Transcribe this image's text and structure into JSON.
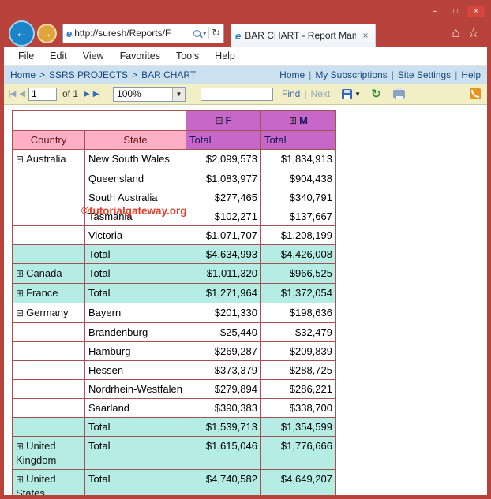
{
  "window": {
    "controls": {
      "minimize": "–",
      "maximize": "□",
      "close": "×"
    }
  },
  "browser": {
    "back_icon": "←",
    "forward_icon": "→",
    "ie_icon": "e",
    "address": {
      "url": "http://suresh/Reports/F",
      "caret": "▾",
      "refresh": "↻"
    },
    "tab": {
      "title": "BAR CHART - Report Mana...",
      "close": "×"
    },
    "home_icon": "⌂",
    "star_icon": "☆"
  },
  "menu": {
    "items": [
      "File",
      "Edit",
      "View",
      "Favorites",
      "Tools",
      "Help"
    ]
  },
  "breadcrumb": {
    "items": [
      "Home",
      "SSRS PROJECTS",
      "BAR CHART"
    ],
    "separator": ">"
  },
  "site_links": {
    "items": [
      "Home",
      "My Subscriptions",
      "Site Settings",
      "Help"
    ],
    "separator": "|"
  },
  "toolbar": {
    "first": "|◀",
    "prev": "◀",
    "page_value": "1",
    "page_of": "of 1",
    "next": "▶",
    "last": "▶|",
    "zoom_value": "100%",
    "zoom_caret": "▼",
    "find_label": "Find",
    "find_separator": "|",
    "next_label": "Next",
    "export_caret": "▼",
    "refresh_icon": "↻"
  },
  "report": {
    "watermark": "©tutorialgateway.org",
    "header": {
      "expand_collapsed": "⊞",
      "expand_expanded": "⊟",
      "f_label": "F",
      "m_label": "M",
      "total_label": "Total",
      "country_label": "Country",
      "state_label": "State"
    },
    "rows": [
      {
        "country": "Australia",
        "expand": "expanded",
        "state": "New South Wales",
        "f": "$2,099,573",
        "m": "$1,834,913",
        "total": false
      },
      {
        "country": "",
        "expand": null,
        "state": "Queensland",
        "f": "$1,083,977",
        "m": "$904,438",
        "total": false
      },
      {
        "country": "",
        "expand": null,
        "state": "South Australia",
        "f": "$277,465",
        "m": "$340,791",
        "total": false
      },
      {
        "country": "",
        "expand": null,
        "state": "Tasmania",
        "f": "$102,271",
        "m": "$137,667",
        "total": false
      },
      {
        "country": "",
        "expand": null,
        "state": "Victoria",
        "f": "$1,071,707",
        "m": "$1,208,199",
        "total": false
      },
      {
        "country": "",
        "expand": null,
        "state": "Total",
        "f": "$4,634,993",
        "m": "$4,426,008",
        "total": true
      },
      {
        "country": "Canada",
        "expand": "collapsed",
        "state": "Total",
        "f": "$1,011,320",
        "m": "$966,525",
        "total": true
      },
      {
        "country": "France",
        "expand": "collapsed",
        "state": "Total",
        "f": "$1,271,964",
        "m": "$1,372,054",
        "total": true
      },
      {
        "country": "Germany",
        "expand": "expanded",
        "state": "Bayern",
        "f": "$201,330",
        "m": "$198,636",
        "total": false
      },
      {
        "country": "",
        "expand": null,
        "state": "Brandenburg",
        "f": "$25,440",
        "m": "$32,479",
        "total": false
      },
      {
        "country": "",
        "expand": null,
        "state": "Hamburg",
        "f": "$269,287",
        "m": "$209,839",
        "total": false
      },
      {
        "country": "",
        "expand": null,
        "state": "Hessen",
        "f": "$373,379",
        "m": "$288,725",
        "total": false
      },
      {
        "country": "",
        "expand": null,
        "state": "Nordrhein-Westfalen",
        "f": "$279,894",
        "m": "$286,221",
        "total": false
      },
      {
        "country": "",
        "expand": null,
        "state": "Saarland",
        "f": "$390,383",
        "m": "$338,700",
        "total": false
      },
      {
        "country": "",
        "expand": null,
        "state": "Total",
        "f": "$1,539,713",
        "m": "$1,354,599",
        "total": true
      },
      {
        "country": "United Kingdom",
        "expand": "collapsed",
        "state": "Total",
        "f": "$1,615,046",
        "m": "$1,776,666",
        "total": true
      },
      {
        "country": "United States",
        "expand": "collapsed",
        "state": "Total",
        "f": "$4,740,582",
        "m": "$4,649,207",
        "total": true
      }
    ]
  },
  "colors": {
    "window_red": "#b8433c",
    "header_magenta": "#c767c7",
    "header_pink": "#ffafc5",
    "total_row_cyan": "#b5ece4",
    "table_border_maroon": "#a35252",
    "breadcrumb_blue": "#cce1f0",
    "toolbar_tan": "#f2eec6",
    "watermark_red": "#e2402a",
    "link_navy": "#17477e"
  }
}
